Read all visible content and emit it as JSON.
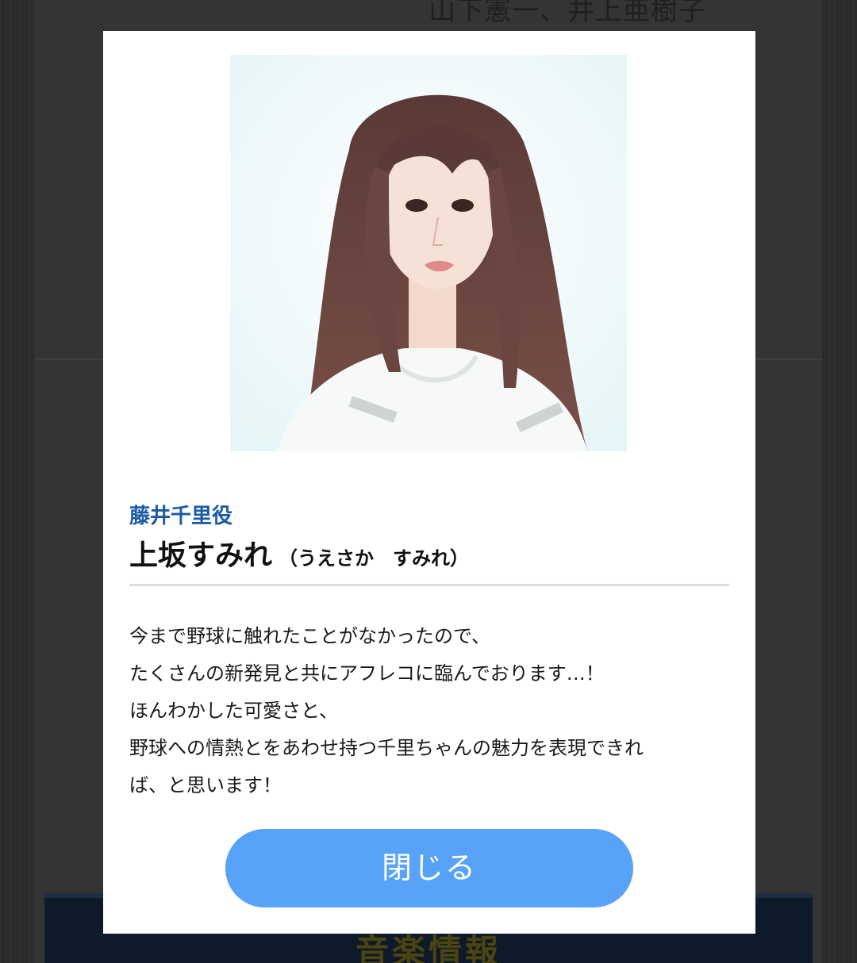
{
  "background": {
    "cast_text": "山下憲一、井上亜樹子",
    "section_heading": "音楽情報"
  },
  "modal": {
    "portrait_icon": "portrait-photo",
    "role": "藤井千里役",
    "name": "上坂すみれ",
    "reading": "（うえさか　すみれ）",
    "comment_lines": [
      "今まで野球に触れたことがなかったので、",
      "たくさんの新発見と共にアフレコに臨んでおります…！",
      "ほんわかした可愛さと、",
      "野球への情熱とをあわせ持つ千里ちゃんの魅力を表現できれ",
      "ば、と思います！"
    ],
    "close_label": "閉じる"
  },
  "colors": {
    "overlay_bg": "#2b2b2b",
    "role_text": "#1b5aa6",
    "close_button": "#58a2f8",
    "modal_bg": "#ffffff"
  }
}
